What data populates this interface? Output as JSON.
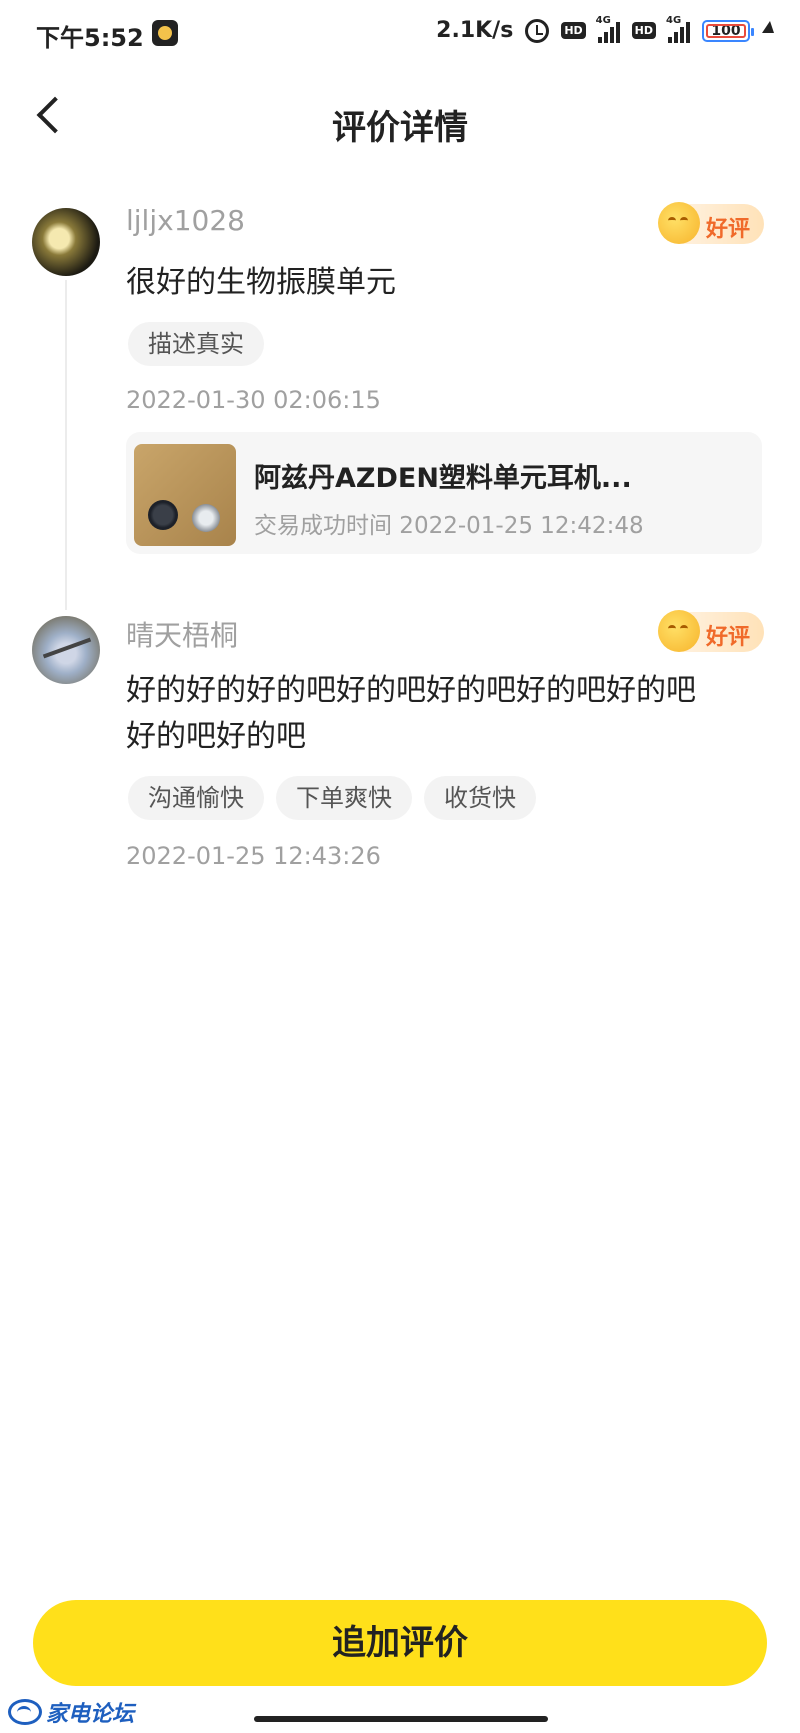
{
  "status_bar": {
    "time": "下午5:52",
    "speed": "2.1K/s",
    "hd_1": "HD",
    "net_1": "4G",
    "hd_2": "HD",
    "net_2": "4G",
    "battery": "100"
  },
  "header": {
    "title": "评价详情"
  },
  "reviews": [
    {
      "username": "ljljx1028",
      "rating_label": "好评",
      "text": "很好的生物振膜单元",
      "tags": [
        "描述真实"
      ],
      "time": "2022-01-30 02:06:15",
      "product": {
        "title": "阿兹丹AZDEN塑料单元耳机...",
        "subtitle": "交易成功时间 2022-01-25 12:42:48"
      }
    },
    {
      "username": "晴天梧桐",
      "rating_label": "好评",
      "text_line1": "好的好的好的吧好的吧好的吧好的吧好的吧",
      "text_line2": "好的吧好的吧",
      "tags": [
        "沟通愉快",
        "下单爽快",
        "收货快"
      ],
      "time": "2022-01-25 12:43:26"
    }
  ],
  "footer": {
    "button_label": "追加评价",
    "watermark": "家电论坛"
  },
  "colors": {
    "accent": "#ffe01a",
    "badge_text": "#f06a2a",
    "muted": "#a0a0a0"
  }
}
